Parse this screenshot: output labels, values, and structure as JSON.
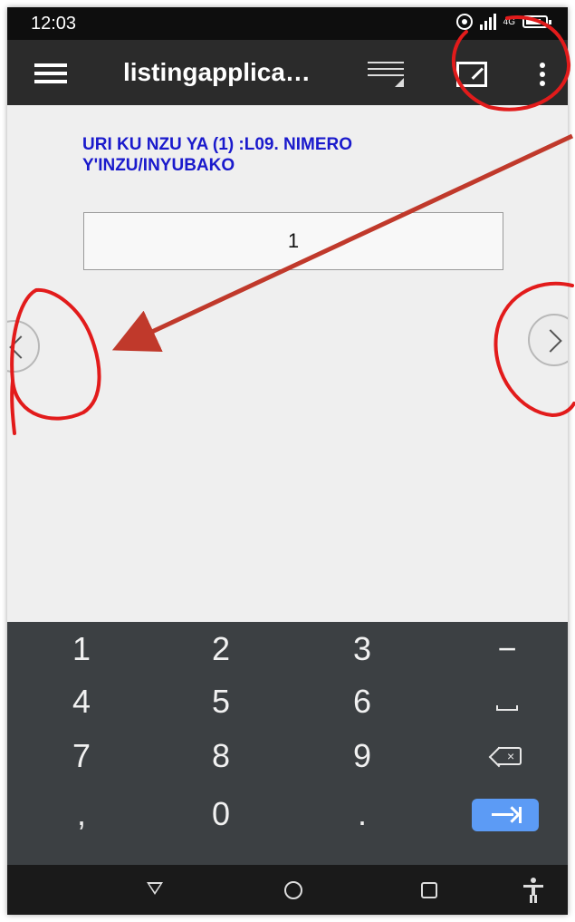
{
  "status_bar": {
    "time": "12:03",
    "network": "4G"
  },
  "app_bar": {
    "title": "listingapplica…",
    "icons": [
      "menu-icon",
      "sort-icon",
      "edit-icon",
      "more-vert-icon"
    ]
  },
  "form": {
    "question": "URI KU NZU YA (1) :L09. NIMERO Y'INZU/INYUBAKO",
    "answer_value": "1"
  },
  "navigation": {
    "prev_icon": "chevron-left-icon",
    "next_icon": "chevron-right-icon"
  },
  "keyboard": {
    "keys": [
      "1",
      "2",
      "3",
      "−",
      "4",
      "5",
      "6",
      "7",
      "8",
      "9",
      ",",
      "0",
      "."
    ],
    "special_icons": [
      "space-icon",
      "backspace-icon",
      "enter-icon"
    ],
    "accent": "#5c9bf5"
  },
  "system_nav": {
    "icons": [
      "back-icon",
      "home-icon",
      "recents-icon",
      "accessibility-icon"
    ]
  },
  "annotations": {
    "color": "#e21b1b",
    "arrow_color": "#c0392b"
  }
}
